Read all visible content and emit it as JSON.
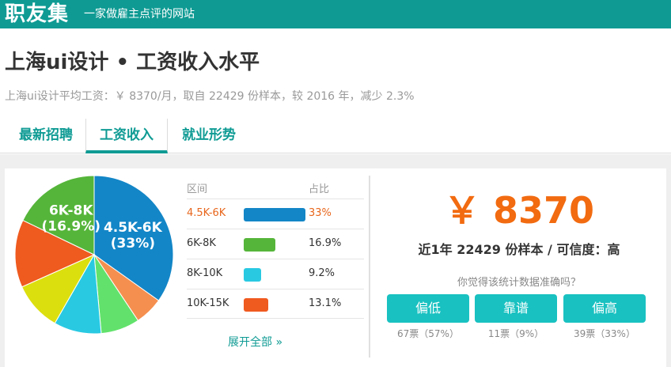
{
  "header": {
    "logo": "职友集",
    "slogan": "一家做雇主点评的网站"
  },
  "title": "上海ui设计 • 工资收入水平",
  "summary": "上海ui设计平均工资：￥ 8370/月，取自 22429 份样本，较 2016 年，减少 2.3%",
  "tabs": [
    {
      "label": "最新招聘"
    },
    {
      "label": "工资收入"
    },
    {
      "label": "就业形势"
    }
  ],
  "active_tab": "工资收入",
  "chart_data": {
    "type": "pie",
    "slices": [
      {
        "name": "4.5K-6K",
        "value": 33,
        "color": "#1386c7",
        "label": "4.5K-6K",
        "pct": "(33%)"
      },
      {
        "name": "slice-orange-light",
        "value": 5.5,
        "color": "#f58f4f"
      },
      {
        "name": "slice-green-light",
        "value": 7.5,
        "color": "#62e26c"
      },
      {
        "name": "10K-15K-or-cyan",
        "value": 9.2,
        "color": "#29c9e2"
      },
      {
        "name": "slice-yellow",
        "value": 9.5,
        "color": "#dcdf0e"
      },
      {
        "name": "10K-15K",
        "value": 13.1,
        "color": "#ef5a1f"
      },
      {
        "name": "6K-8K",
        "value": 16.9,
        "color": "#55b53a",
        "label": "6K-8K",
        "pct": "(16.9%)"
      }
    ]
  },
  "table": {
    "header_range": "区间",
    "header_share": "占比",
    "rows": [
      {
        "range": "4.5K-6K",
        "share": "33%",
        "value": 33,
        "color": "#1386c7"
      },
      {
        "range": "6K-8K",
        "share": "16.9%",
        "value": 16.9,
        "color": "#55b53a"
      },
      {
        "range": "8K-10K",
        "share": "9.2%",
        "value": 9.2,
        "color": "#29c9e2"
      },
      {
        "range": "10K-15K",
        "share": "13.1%",
        "value": 13.1,
        "color": "#ef5a1f"
      }
    ],
    "expand_label": "展开全部 »"
  },
  "stats": {
    "avg_salary": "￥ 8370",
    "sample_text": "近1年 22429 份样本 / 可信度：高",
    "question": "你觉得该统计数据准确吗？"
  },
  "votes": [
    {
      "label": "偏低",
      "count": "67票（57%）"
    },
    {
      "label": "靠谱",
      "count": "11票（9%）"
    },
    {
      "label": "偏高",
      "count": "39票（33%）"
    }
  ],
  "colors": {
    "brand": "#0f9b94",
    "accent": "#f26b10",
    "button": "#19c1c1"
  }
}
